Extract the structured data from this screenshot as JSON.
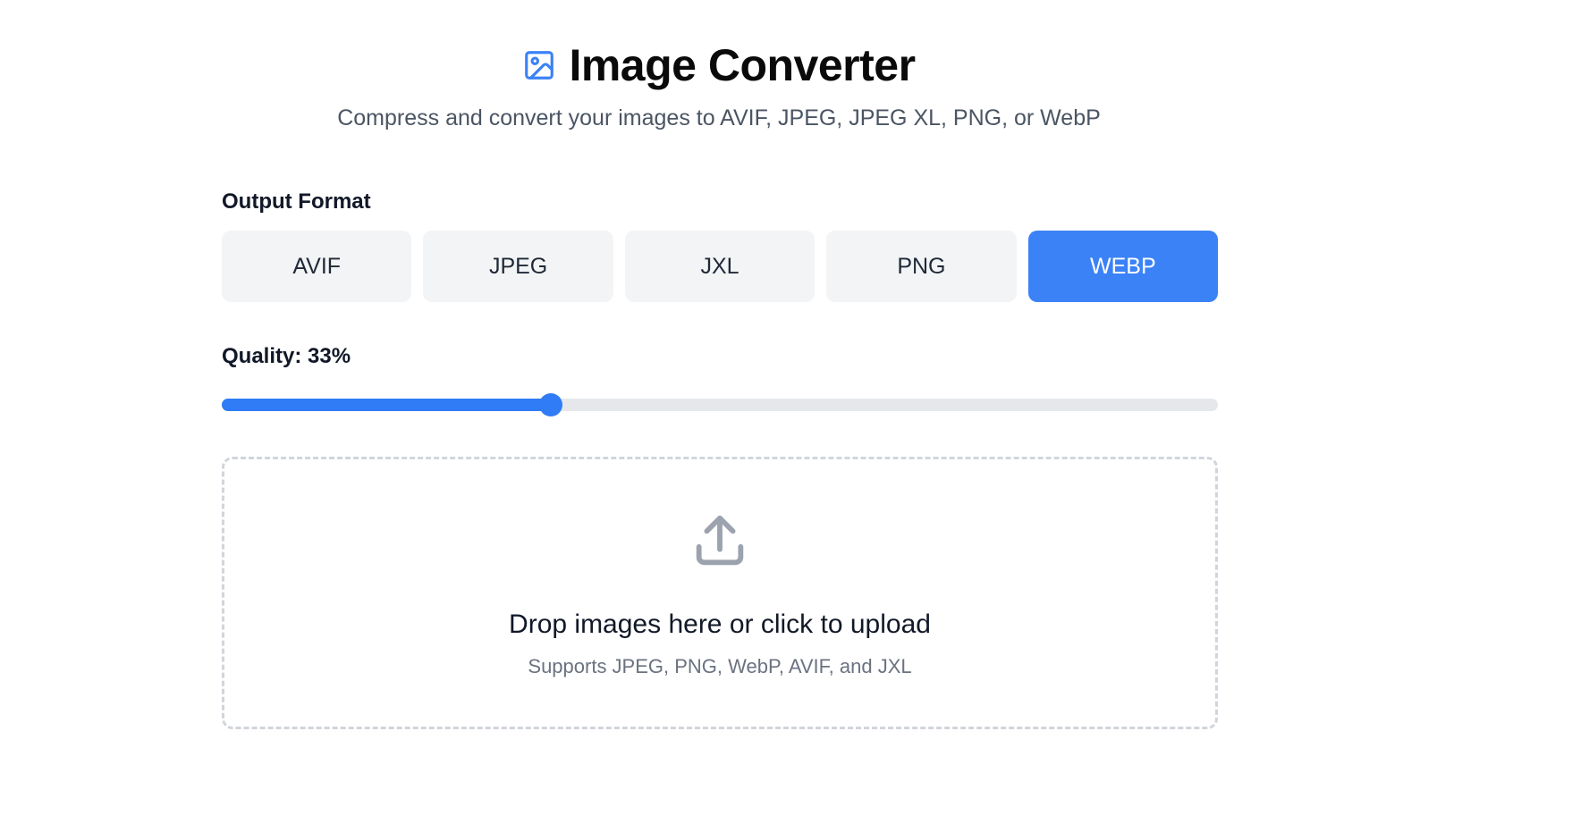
{
  "header": {
    "title": "Image Converter",
    "subtitle": "Compress and convert your images to AVIF, JPEG, JPEG XL, PNG, or WebP",
    "icon": "image-icon"
  },
  "format": {
    "label": "Output Format",
    "options": [
      "AVIF",
      "JPEG",
      "JXL",
      "PNG",
      "WEBP"
    ],
    "selected": "WEBP"
  },
  "quality": {
    "label": "Quality: 33%",
    "value": 33,
    "min": 0,
    "max": 100
  },
  "dropzone": {
    "icon": "upload-icon",
    "text": "Drop images here or click to upload",
    "subtext": "Supports JPEG, PNG, WebP, AVIF, and JXL"
  },
  "colors": {
    "accent": "#3b82f6",
    "button_bg": "#f3f4f6",
    "track": "#e5e7eb",
    "muted_text": "#6b7280",
    "icon_gray": "#9ca3af"
  }
}
